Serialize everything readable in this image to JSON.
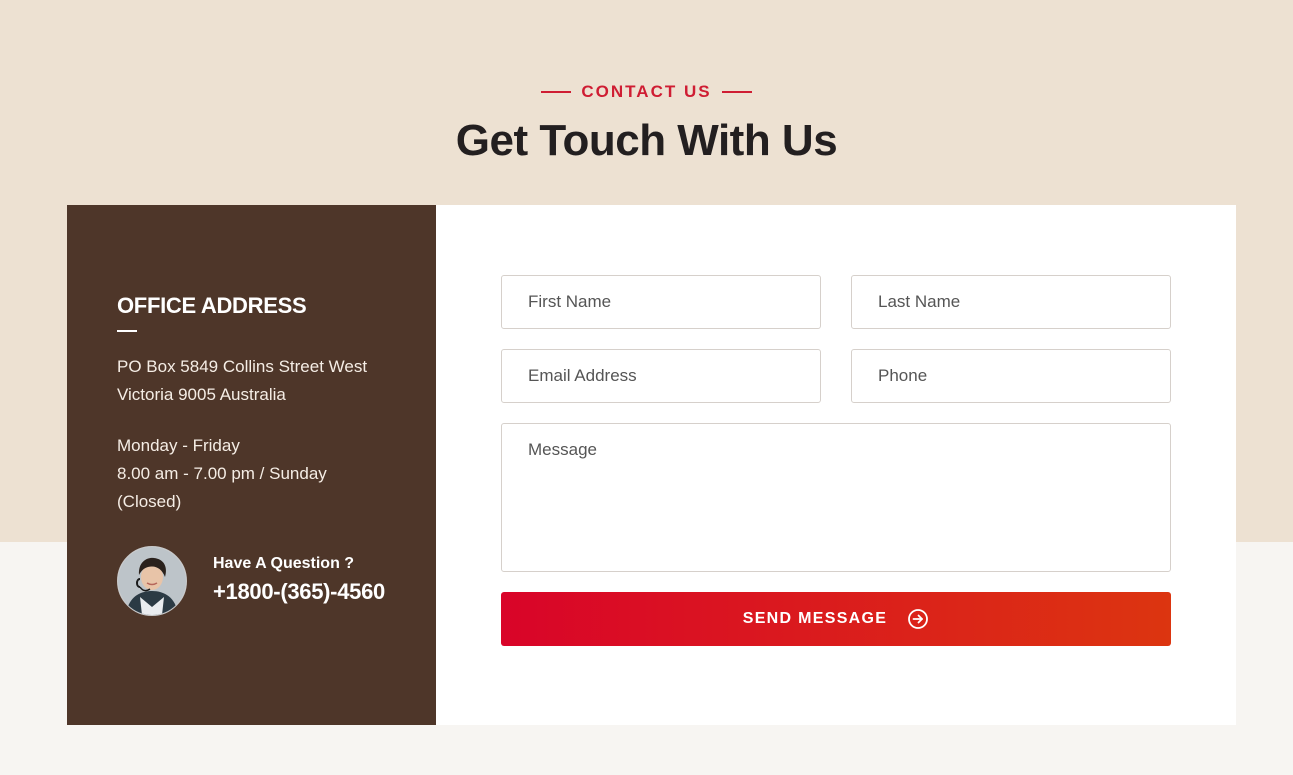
{
  "header": {
    "eyebrow": "CONTACT US",
    "title": "Get Touch With Us"
  },
  "sidebar": {
    "office_title": "OFFICE ADDRESS",
    "address_line1": "PO Box 5849 Collins Street West",
    "address_line2": "Victoria 9005 Australia",
    "hours_line1": "Monday - Friday",
    "hours_line2": "8.00 am - 7.00 pm / Sunday",
    "hours_line3": "(Closed)",
    "question": "Have A Question ?",
    "phone": "+1800-(365)-4560",
    "avatar_icon": "support-agent-avatar"
  },
  "form": {
    "first_name_placeholder": "First Name",
    "last_name_placeholder": "Last Name",
    "email_placeholder": "Email Address",
    "phone_placeholder": "Phone",
    "message_placeholder": "Message",
    "submit_label": "SEND MESSAGE",
    "submit_icon": "arrow-right-circle-icon"
  },
  "colors": {
    "accent": "#cf1d33",
    "sidebar_bg": "#4e3629",
    "top_band_bg": "#ede1d2",
    "page_bg": "#f7f5f2",
    "button_gradient_start": "#d90429",
    "button_gradient_end": "#dc3510"
  }
}
